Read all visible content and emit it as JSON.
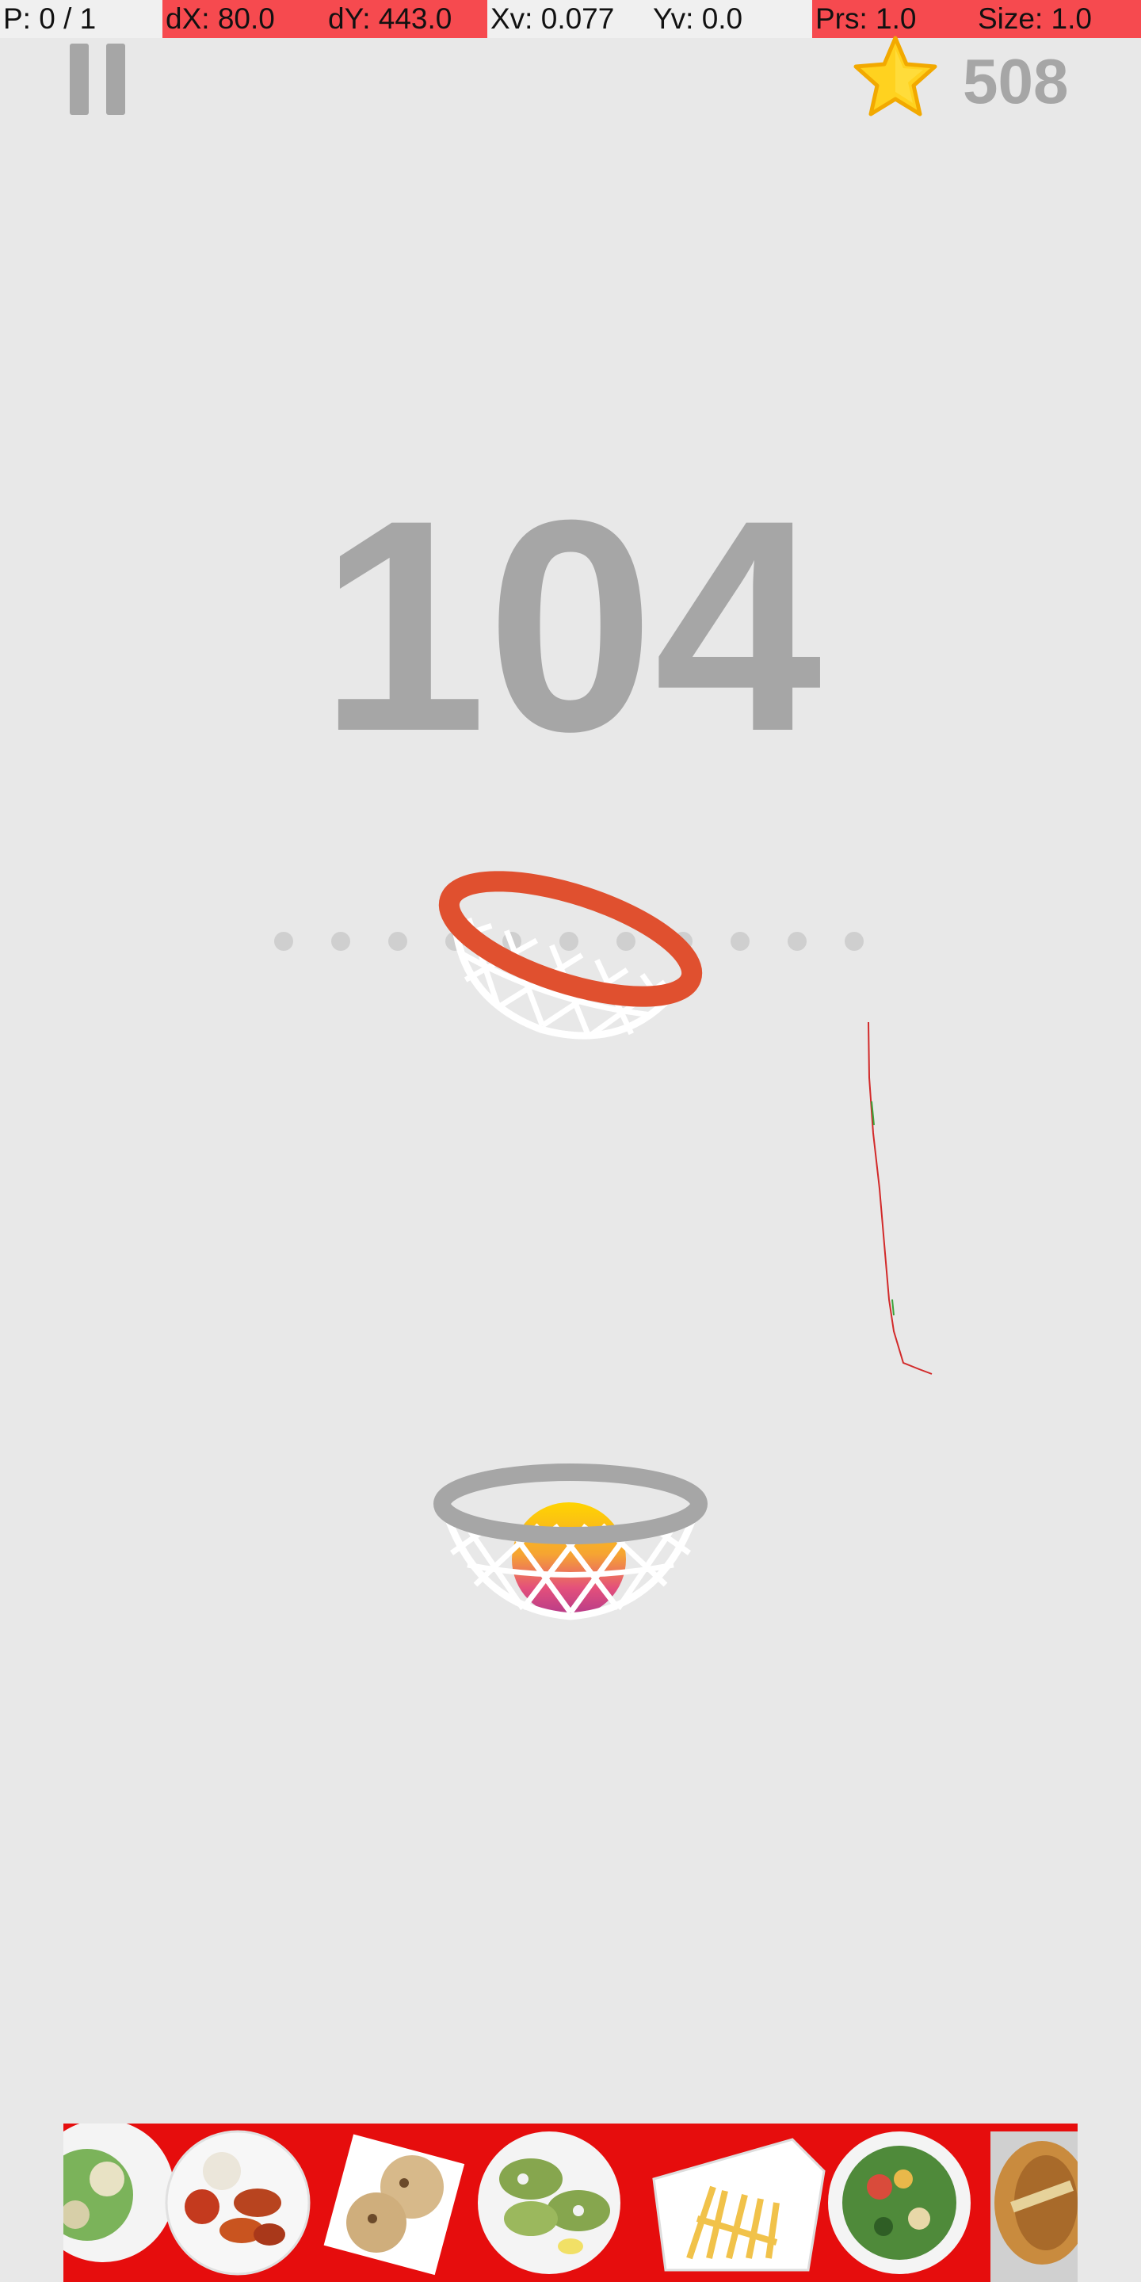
{
  "debug": {
    "pointer": "P: 0 / 1",
    "dx": "dX: 80.0",
    "dy": "dY: 443.0",
    "xv": "Xv: 0.077",
    "yv": "Yv: 0.0",
    "prs": "Prs: 1.0",
    "size": "Size: 1.0"
  },
  "hud": {
    "pause_icon": "pause-icon",
    "star_icon": "star-icon",
    "coins": "508"
  },
  "game": {
    "score": "104",
    "target_hoop_color": "#e0502f",
    "launch_hoop_color": "#a6a6a6",
    "trajectory_dots_count": 11
  },
  "ad": {
    "items": [
      "salad-plate",
      "wings-plate",
      "cookies",
      "avocado-toast",
      "fries-container",
      "salad-bowl",
      "sandwich"
    ]
  },
  "colors": {
    "background": "#e8e8e8",
    "ad_background": "#e60d0d",
    "debug_red": "#f64a4f"
  }
}
